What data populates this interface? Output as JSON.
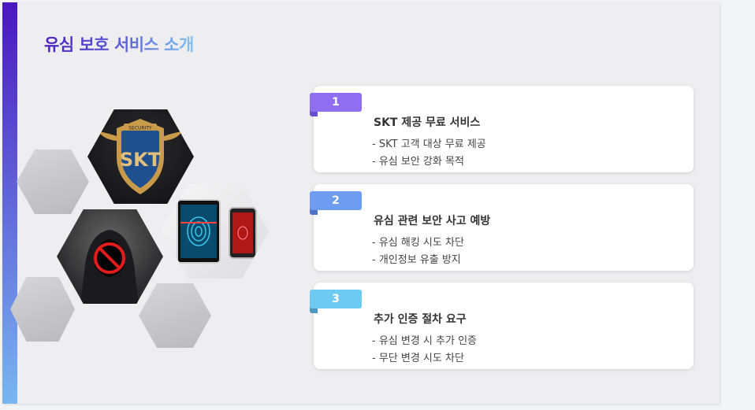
{
  "slide": {
    "title": "유심 보호 서비스 소개"
  },
  "images": {
    "shield_emblem_text": "SECURITY",
    "shield_letters": "SKT"
  },
  "cards": [
    {
      "number": "1",
      "badge_color": "#8f6ef2",
      "tail_color": "#6a4fd0",
      "title": "SKT 제공 무료 서비스",
      "items": [
        "- SKT 고객 대상 무료 제공",
        "- 유심 보안 강화 목적"
      ]
    },
    {
      "number": "2",
      "badge_color": "#6d9cf0",
      "tail_color": "#4f74c7",
      "title": "유심 관련 보안 사고 예방",
      "items": [
        "- 유심 해킹 시도 차단",
        "- 개인정보 유출 방지"
      ]
    },
    {
      "number": "3",
      "badge_color": "#6fcaf2",
      "tail_color": "#4f96be",
      "title": "추가 인증 절차 요구",
      "items": [
        "- 유심 변경 시 추가 인증",
        "- 무단 변경 시도 차단"
      ]
    }
  ]
}
